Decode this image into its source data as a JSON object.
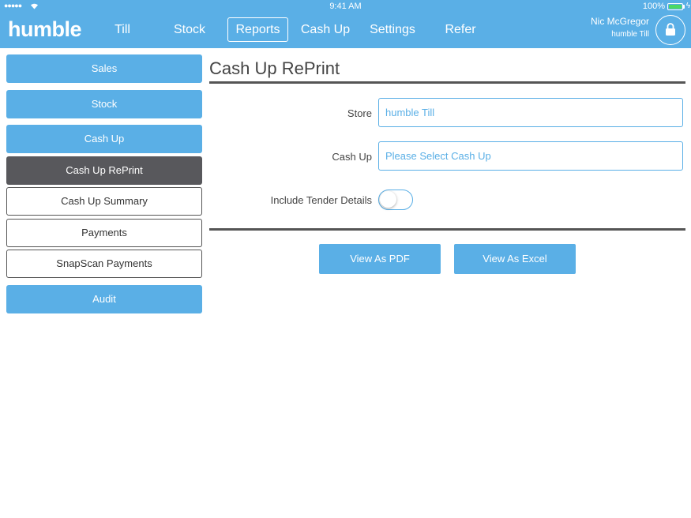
{
  "status_bar": {
    "signal": "●●●●●",
    "time": "9:41 AM",
    "battery": "100%"
  },
  "app": {
    "logo": "humble"
  },
  "nav": {
    "items": [
      "Till",
      "Stock",
      "Reports",
      "Cash Up",
      "Settings",
      "Refer"
    ],
    "active": "Reports"
  },
  "user": {
    "name": "Nic McGregor",
    "store": "humble Till"
  },
  "sidebar": {
    "items": [
      {
        "label": "Sales",
        "style": "blue"
      },
      {
        "label": "Stock",
        "style": "blue"
      },
      {
        "label": "Cash Up",
        "style": "blue"
      },
      {
        "label": "Cash Up RePrint",
        "style": "selected"
      },
      {
        "label": "Cash Up Summary",
        "style": "outline"
      },
      {
        "label": "Payments",
        "style": "outline"
      },
      {
        "label": "SnapScan Payments",
        "style": "outline"
      },
      {
        "label": "Audit",
        "style": "blue"
      }
    ]
  },
  "main": {
    "title": "Cash Up RePrint",
    "store_label": "Store",
    "store_value": "humble Till",
    "cashup_label": "Cash Up",
    "cashup_placeholder": "Please Select Cash Up",
    "tender_label": "Include Tender Details",
    "tender_enabled": false,
    "pdf_button": "View As PDF",
    "excel_button": "View As Excel"
  },
  "colors": {
    "accent": "#5aafe6",
    "selected": "#58585c",
    "battery": "#4cd964"
  }
}
